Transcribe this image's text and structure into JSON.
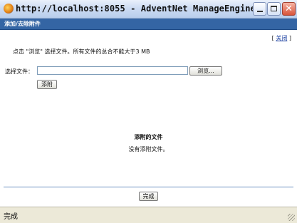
{
  "window": {
    "title": "http://localhost:8055 - AdventNet ManageEngine ...",
    "buttons": {
      "minimize_icon": "minimize-icon",
      "maximize_icon": "maximize-icon",
      "close_icon": "close-icon",
      "close_glyph": "✕"
    }
  },
  "header": {
    "title": "添加/去除附件"
  },
  "dialog": {
    "close_link_open": "[",
    "close_link": "关闭",
    "close_link_close": "]",
    "instruction": "点击 \"浏览\" 选择文件。所有文件的总合不能大于3 MB",
    "file_label": "选择文件：",
    "file_value": "",
    "browse_label": "浏览...",
    "attach_label": "添附",
    "attached_title": "添附的文件",
    "no_files_text": "没有添附文件。",
    "done_label": "完成"
  },
  "status": {
    "text": "完成"
  },
  "colors": {
    "header_bg": "#3465a4",
    "link": "#1a3fa0",
    "separator": "#6b8fc0"
  }
}
